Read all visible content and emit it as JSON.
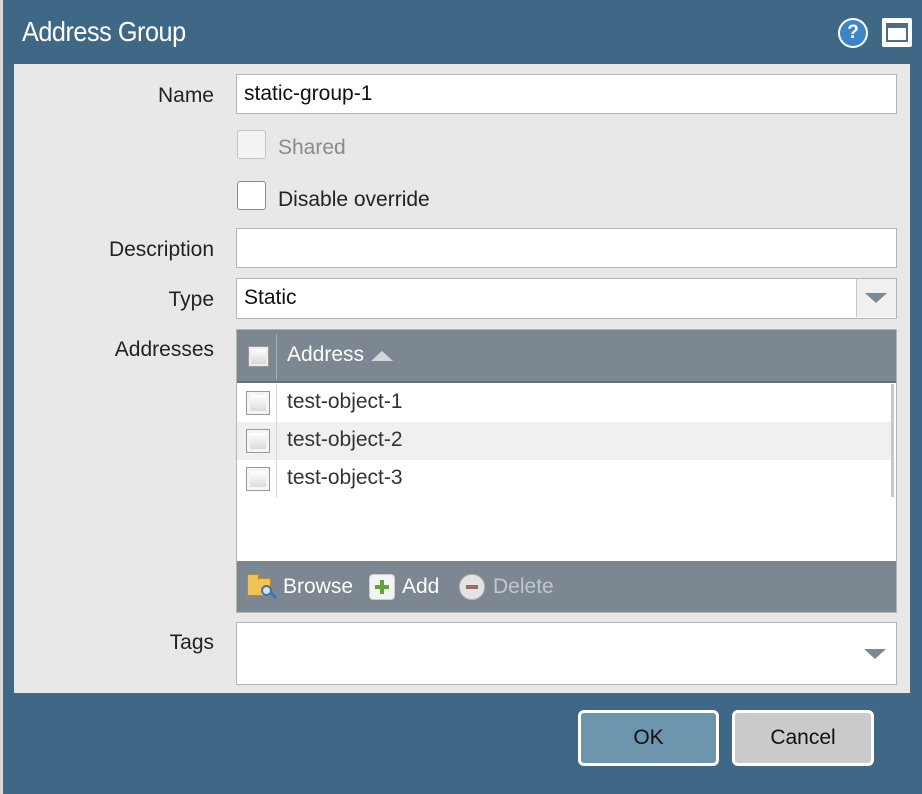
{
  "dialog": {
    "title": "Address Group"
  },
  "titlebar": {
    "help_icon": "help-icon",
    "help_glyph": "?",
    "maximize_icon": "maximize-icon"
  },
  "form": {
    "name": {
      "label": "Name",
      "value": "static-group-1"
    },
    "shared": {
      "label": "Shared",
      "checked": false,
      "disabled": true
    },
    "disable_override": {
      "label": "Disable override",
      "checked": false
    },
    "description": {
      "label": "Description",
      "value": ""
    },
    "type": {
      "label": "Type",
      "value": "Static"
    },
    "addresses": {
      "label": "Addresses",
      "column_header": "Address",
      "sort": "ascending",
      "rows": [
        {
          "name": "test-object-1"
        },
        {
          "name": "test-object-2"
        },
        {
          "name": "test-object-3"
        }
      ],
      "toolbar": {
        "browse": "Browse",
        "add": "Add",
        "delete": "Delete"
      }
    },
    "tags": {
      "label": "Tags",
      "value": ""
    }
  },
  "buttons": {
    "ok": "OK",
    "cancel": "Cancel"
  },
  "colors": {
    "titlebar": "#3e6885",
    "panel": "#e8e8e8",
    "grid_header": "#7c8791",
    "ok_button": "#6d95ae"
  }
}
